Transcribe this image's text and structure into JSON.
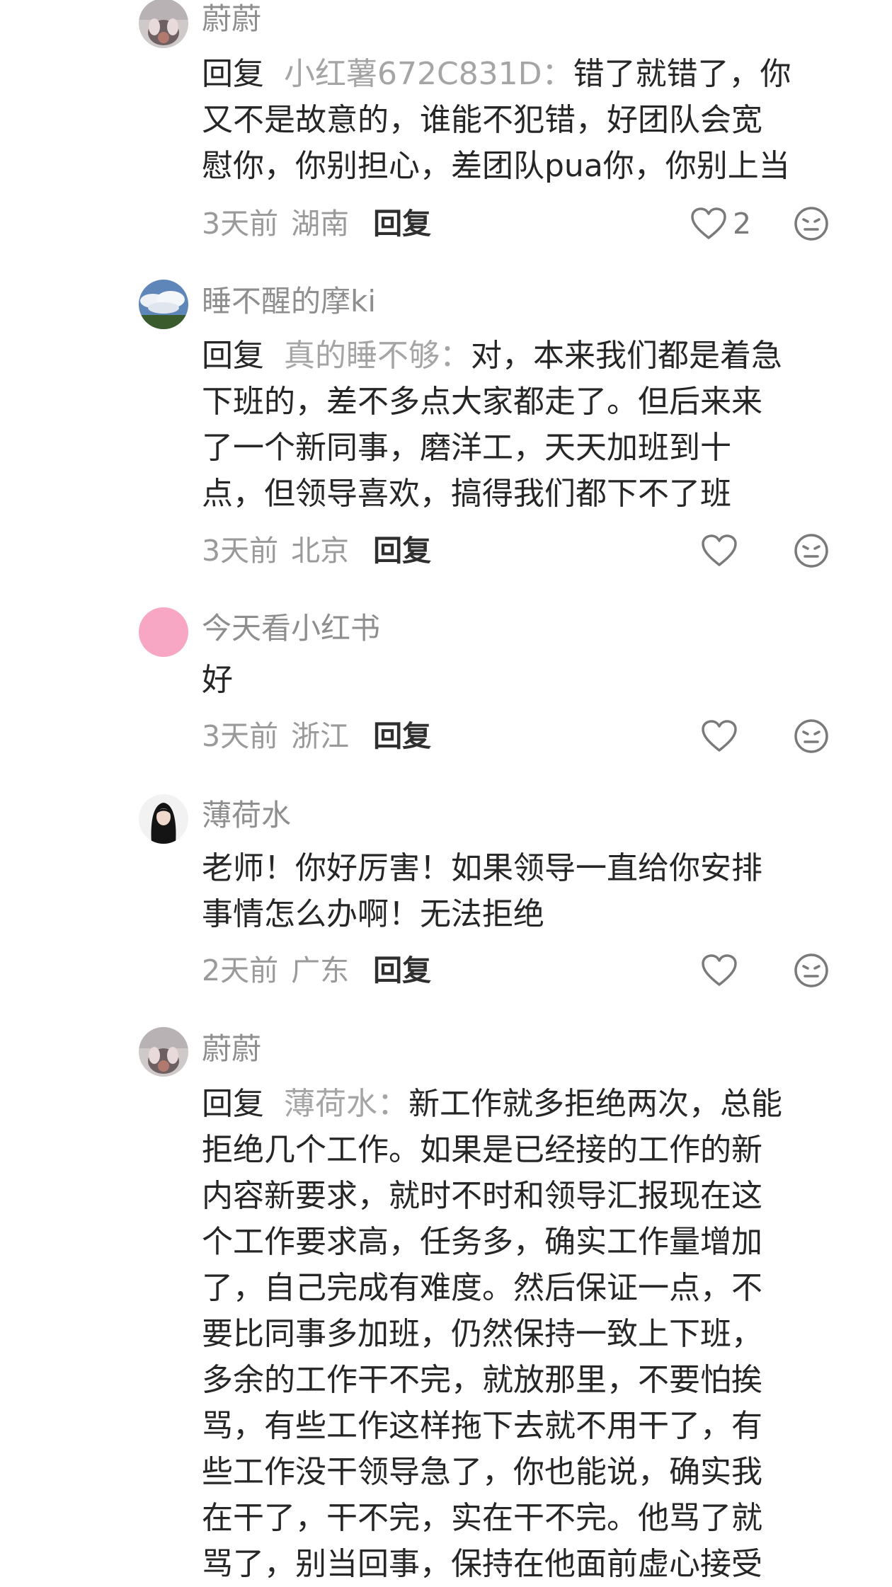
{
  "comments": [
    {
      "username": "蔚蔚",
      "reply_word": "回复",
      "reply_target": "小红薯672C831D：",
      "lines": [
        "错了就错了，你",
        "又不是故意的，谁能不犯错，好团队会宽",
        "慰你，你别担心，差团队pua你，你别上当"
      ],
      "time": "3天前",
      "location": "湖南",
      "reply_label": "回复",
      "like_count": "2",
      "like_icon": "heart-outline-icon",
      "dislike_icon": "meh-face-icon"
    },
    {
      "username": "睡不醒的摩ki",
      "reply_word": "回复",
      "reply_target": "真的睡不够：",
      "lines": [
        "对，本来我们都是着急",
        "下班的，差不多点大家都走了。但后来来",
        "了一个新同事，磨洋工，天天加班到十",
        "点，但领导喜欢，搞得我们都下不了班"
      ],
      "time": "3天前",
      "location": "北京",
      "reply_label": "回复",
      "like_count": "",
      "like_icon": "heart-outline-icon",
      "dislike_icon": "meh-face-icon"
    },
    {
      "username": "今天看小红书",
      "lines": [
        "好"
      ],
      "time": "3天前",
      "location": "浙江",
      "reply_label": "回复",
      "like_count": "",
      "like_icon": "heart-outline-icon",
      "dislike_icon": "meh-face-icon"
    },
    {
      "username": "薄荷水",
      "lines": [
        "老师！你好厉害！如果领导一直给你安排",
        "事情怎么办啊！无法拒绝"
      ],
      "time": "2天前",
      "location": "广东",
      "reply_label": "回复",
      "like_count": "",
      "like_icon": "heart-outline-icon",
      "dislike_icon": "meh-face-icon"
    },
    {
      "username": "蔚蔚",
      "reply_word": "回复",
      "reply_target": "薄荷水：",
      "lines": [
        "新工作就多拒绝两次，总能",
        "拒绝几个工作。如果是已经接的工作的新",
        "内容新要求，就时不时和领导汇报现在这",
        "个工作要求高，任务多，确实工作量增加",
        "了，自己完成有难度。然后保证一点，不",
        "要比同事多加班，仍然保持一致上下班，",
        "多余的工作干不完，就放那里，不要怕挨",
        "骂，有些工作这样拖下去就不用干了，有",
        "些工作没干领导急了，你也能说，确实我",
        "在干了，干不完，实在干不完。他骂了就",
        "骂了，别当回事，保持在他面前虚心接受"
      ]
    }
  ],
  "colors": {
    "username": "#8e8e8e",
    "body_text": "#262626",
    "reply_target": "#a5a5a5",
    "meta": "#9a9a9a",
    "icon": "#7a7a7a",
    "pink_avatar": "#f7a6c3"
  }
}
